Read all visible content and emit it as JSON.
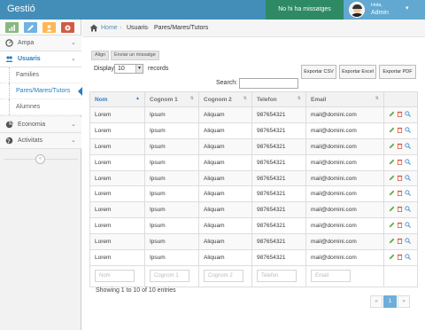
{
  "app": {
    "title": "Gestió"
  },
  "topbar": {
    "messages": "No hi ha missatges pendents",
    "greeting": "Hola,",
    "user": "Admin"
  },
  "shortcuts": [
    {
      "icon": "signal-icon",
      "color": "#87b87f"
    },
    {
      "icon": "pencil-icon",
      "color": "#6fb3e0"
    },
    {
      "icon": "users-icon",
      "color": "#ffb752"
    },
    {
      "icon": "cogs-icon",
      "color": "#d15b47"
    }
  ],
  "sidebar": {
    "items": [
      {
        "label": "Ampa",
        "icon": "dashboard-icon"
      },
      {
        "label": "Usuaris",
        "icon": "users-icon"
      },
      {
        "label": "Economia",
        "icon": "chart-icon"
      },
      {
        "label": "Activitats",
        "icon": "globe-icon"
      }
    ],
    "subitems": [
      {
        "label": "Families"
      },
      {
        "label": "Pares/Mares/Tutors"
      },
      {
        "label": "Alumnes"
      }
    ],
    "collapse": "«"
  },
  "breadcrumb": {
    "home": "Home",
    "section": "Usuaris",
    "page": "Pares/Mares/Tutors"
  },
  "toolbar": {
    "align": "Align",
    "send_message": "Enviar un missatge",
    "display": "Display",
    "records": "records",
    "page_size": "10",
    "search_label": "Search:",
    "export_csv": "Exportar CSV",
    "export_excel": "Exportar Excel",
    "export_pdf": "Exportar PDF"
  },
  "table": {
    "columns": [
      "Nom",
      "Cognom 1",
      "Cognom 2",
      "Telefon",
      "Email",
      ""
    ],
    "rows": [
      [
        "Lorem",
        "Ipsum",
        "Aliquam",
        "987654321",
        "mail@domini.com"
      ],
      [
        "Lorem",
        "Ipsum",
        "Aliquam",
        "987654321",
        "mail@domini.com"
      ],
      [
        "Lorem",
        "Ipsum",
        "Aliquam",
        "987654321",
        "mail@domini.com"
      ],
      [
        "Lorem",
        "Ipsum",
        "Aliquam",
        "987654321",
        "mail@domini.com"
      ],
      [
        "Lorem",
        "Ipsum",
        "Aliquam",
        "987654321",
        "mail@domini.com"
      ],
      [
        "Lorem",
        "Ipsum",
        "Aliquam",
        "987654321",
        "mail@domini.com"
      ],
      [
        "Lorem",
        "Ipsum",
        "Aliquam",
        "987654321",
        "mail@domini.com"
      ],
      [
        "Lorem",
        "Ipsum",
        "Aliquam",
        "987654321",
        "mail@domini.com"
      ],
      [
        "Lorem",
        "Ipsum",
        "Aliquam",
        "987654321",
        "mail@domini.com"
      ],
      [
        "Lorem",
        "Ipsum",
        "Aliquam",
        "987654321",
        "mail@domini.com"
      ]
    ],
    "filters": [
      "Nom",
      "Cognom 1",
      "Cognom 2",
      "Telefon",
      "Email"
    ]
  },
  "footer": {
    "info": "Showing 1 to 10 of 10 entries"
  },
  "pagination": {
    "prev": "«",
    "current": "1",
    "next": "»"
  },
  "colors": {
    "topbar": "#438eb9",
    "accent": "#2b7dbc",
    "edit": "#69aa46",
    "delete": "#dd5a43",
    "view": "#478fca"
  }
}
